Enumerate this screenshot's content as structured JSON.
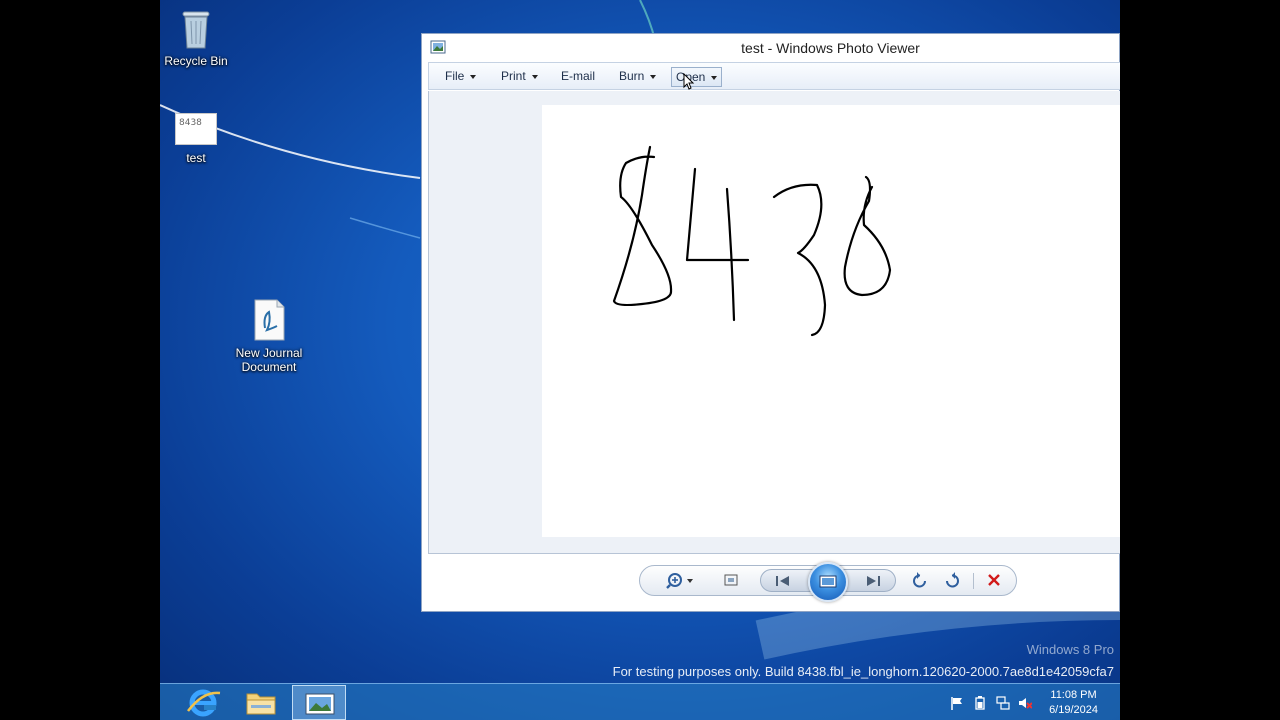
{
  "desktop": {
    "icons": [
      {
        "label": "Recycle Bin"
      },
      {
        "label": "test",
        "thumb_text": "8438"
      },
      {
        "label": "New Journal Document"
      }
    ],
    "watermark": "Windows 8 Pro",
    "build_text": "For testing purposes only. Build 8438.fbl_ie_longhorn.120620-2000.7ae8d1e42059cfa7"
  },
  "viewer": {
    "title": "test - Windows Photo Viewer",
    "menu": [
      {
        "label": "File"
      },
      {
        "label": "Print"
      },
      {
        "label": "E-mail"
      },
      {
        "label": "Burn"
      },
      {
        "label": "Open"
      }
    ],
    "photo_text": "8438",
    "controls": [
      "zoom-icon",
      "fit-window-icon",
      "previous-icon",
      "slideshow-icon",
      "next-icon",
      "rotate-ccw-icon",
      "rotate-cw-icon",
      "delete-icon"
    ]
  },
  "taskbar": {
    "apps": [
      "internet-explorer-icon",
      "file-explorer-icon",
      "photo-viewer-icon"
    ],
    "tray": [
      "flag-icon",
      "power-icon",
      "network-icon",
      "volume-muted-icon"
    ],
    "time": "11:08 PM",
    "date": "6/19/2024"
  },
  "colors": {
    "accent": "#1d6fd3",
    "delete": "#d11a1a"
  }
}
